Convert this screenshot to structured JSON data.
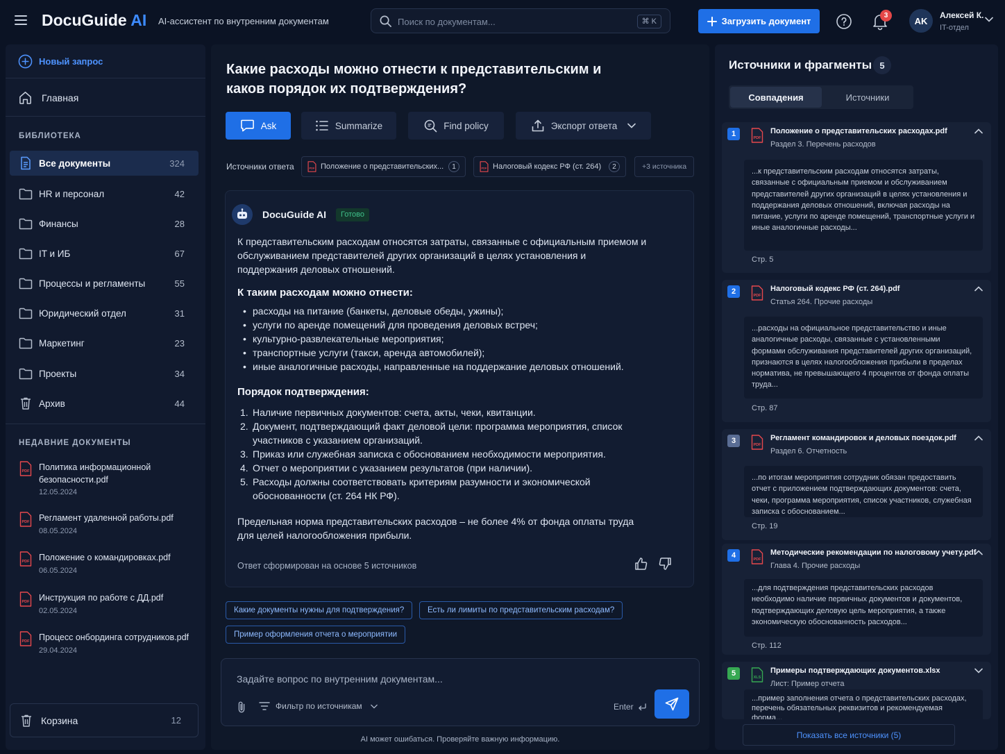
{
  "header": {
    "brand_main": "DocuGuide",
    "brand_ai": "AI",
    "tagline": "AI-ассистент по внутренним документам",
    "search_placeholder": "Поиск по документам...",
    "search_shortcut": "⌘ K",
    "upload_label": "Загрузить документ",
    "notifications_count": "3",
    "user_initials": "AK",
    "user_name": "Алексей К.",
    "user_role": "IT-отдел"
  },
  "sidebar": {
    "new_query": "Новый запрос",
    "home": "Главная",
    "library_title": "БИБЛИОТЕКА",
    "folders": [
      {
        "label": "Все документы",
        "count": "324"
      },
      {
        "label": "HR и персонал",
        "count": "42"
      },
      {
        "label": "Финансы",
        "count": "28"
      },
      {
        "label": "IT и ИБ",
        "count": "67"
      },
      {
        "label": "Процессы и регламенты",
        "count": "55"
      },
      {
        "label": "Юридический отдел",
        "count": "31"
      },
      {
        "label": "Маркетинг",
        "count": "23"
      },
      {
        "label": "Проекты",
        "count": "34"
      },
      {
        "label": "Архив",
        "count": "44"
      }
    ],
    "recent_title": "НЕДАВНИЕ ДОКУМЕНТЫ",
    "recent": [
      {
        "name": "Политика информационной безопасности.pdf",
        "date": "12.05.2024"
      },
      {
        "name": "Регламент удаленной работы.pdf",
        "date": "08.05.2024"
      },
      {
        "name": "Положение о командировках.pdf",
        "date": "06.05.2024"
      },
      {
        "name": "Инструкция по работе с ДД.pdf",
        "date": "02.05.2024"
      },
      {
        "name": "Процесс онбординга сотрудников.pdf",
        "date": "29.04.2024"
      }
    ],
    "trash_label": "Корзина",
    "trash_count": "12"
  },
  "main": {
    "question": "Какие расходы можно отнести к представительским и каков порядок их подтверждения?",
    "actions": {
      "ask": "Ask",
      "summarize": "Summarize",
      "find_policy": "Find policy",
      "export": "Экспорт ответа"
    },
    "sources_label": "Источники ответа",
    "source_chips": [
      {
        "label": "Положение о представительских...",
        "num": "1"
      },
      {
        "label": "Налоговый кодекс РФ (ст. 264)",
        "num": "2"
      }
    ],
    "more_sources": "+3 источника",
    "bot_name": "DocuGuide AI",
    "status": "Готово",
    "intro": "К представительским расходам относятся затраты, связанные с официальным приемом и обслуживанием представителей других организаций в целях установления и поддержания деловых отношений.",
    "list_heading": "К таким расходам можно отнести:",
    "bullets": [
      "расходы на питание (банкеты, деловые обеды, ужины);",
      "услуги по аренде помещений для проведения деловых встреч;",
      "культурно-развлекательные мероприятия;",
      "транспортные услуги (такси, аренда автомобилей);",
      "иные аналогичные расходы, направленные на поддержание деловых отношений."
    ],
    "order_heading": "Порядок подтверждения:",
    "steps": [
      {
        "n": "1.",
        "text": "Наличие первичных документов: счета, акты, чеки, квитанции."
      },
      {
        "n": "2.",
        "text": "Документ, подтверждающий факт деловой цели: программа мероприятия, список участников с указанием организаций."
      },
      {
        "n": "3.",
        "text": "Приказ или служебная записка с обоснованием необходимости мероприятия."
      },
      {
        "n": "4.",
        "text": "Отчет о мероприятии с указанием результатов (при наличии)."
      },
      {
        "n": "5.",
        "text": "Расходы должны соответствовать критериям разумности и экономической обоснованности (ст. 264 НК РФ)."
      }
    ],
    "limit_note": "Предельная норма представительских расходов – не более 4% от фонда оплаты труда для целей налогообложения прибыли.",
    "footer_note": "Ответ сформирован на основе 5 источников",
    "suggestions": [
      "Какие документы нужны для подтверждения?",
      "Есть ли лимиты по представительским расходам?",
      "Пример оформления отчета о мероприятии"
    ],
    "composer_placeholder": "Задайте вопрос по внутренним документам...",
    "filter_label": "Фильтр по источникам",
    "enter_hint": "Enter",
    "disclaimer": "AI может ошибаться. Проверяйте важную информацию."
  },
  "sources_panel": {
    "title": "Источники и фрагменты",
    "count": "5",
    "tabs": [
      "Совпадения",
      "Источники"
    ],
    "cards": [
      {
        "num": "1",
        "color": "#1f6fe6",
        "file": "Положение о представительских расходах.pdf",
        "section": "Раздел 3. Перечень расходов",
        "quote": "...к представительским расходам относятся затраты, связанные с официальным приемом и обслуживанием представителей других организаций в целях установления и поддержания деловых отношений, включая расходы на питание, услуги по аренде помещений, транспортные услуги и иные аналогичные расходы...",
        "page": "Стр. 5",
        "type": "pdf"
      },
      {
        "num": "2",
        "color": "#1f6fe6",
        "file": "Налоговый кодекс РФ (ст. 264).pdf",
        "section": "Статья 264. Прочие расходы",
        "quote": "...расходы на официальное представительство и иные аналогичные расходы, связанные с установленными формами обслуживания представителей других организаций, признаются в целях налогообложения прибыли в пределах норматива, не превышающего 4 процентов от фонда оплаты труда...",
        "page": "Стр. 87",
        "type": "pdf"
      },
      {
        "num": "3",
        "color": "#5a6d94",
        "file": "Регламент командировок и деловых поездок.pdf",
        "section": "Раздел 6. Отчетность",
        "quote": "...по итогам мероприятия сотрудник обязан предоставить отчет с приложением подтверждающих документов: счета, чеки, программа мероприятия, список участников, служебная записка с обоснованием...",
        "page": "Стр. 19",
        "type": "pdf"
      },
      {
        "num": "4",
        "color": "#1f6fe6",
        "file": "Методические рекомендации по налоговому учету.pdf",
        "section": "Глава 4. Прочие расходы",
        "quote": "...для подтверждения представительских расходов необходимо наличие первичных документов и документов, подтверждающих деловую цель мероприятия, а также экономическую обоснованность расходов...",
        "page": "Стр. 112",
        "type": "pdf"
      },
      {
        "num": "5",
        "color": "#36a852",
        "file": "Примеры подтверждающих документов.xlsx",
        "section": "Лист: Пример отчета",
        "quote": "...пример заполнения отчета о представительских расходах, перечень обязательных реквизитов и рекомендуемая форма...",
        "page": "",
        "type": "xls"
      }
    ],
    "show_all": "Показать все источники (5)"
  }
}
